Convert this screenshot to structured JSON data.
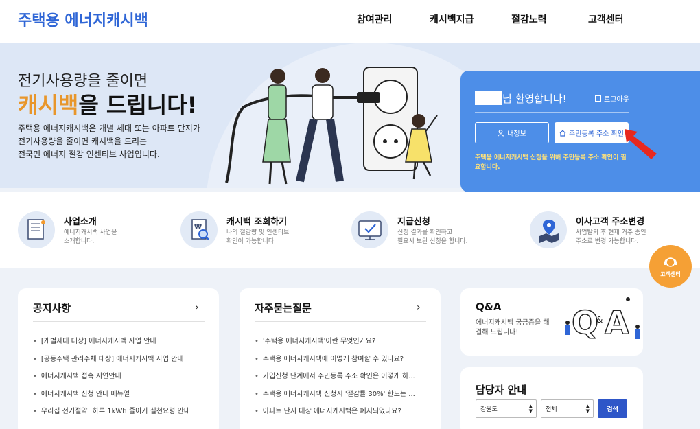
{
  "header": {
    "logo": "주택용 에너지캐시백",
    "nav": [
      "참여관리",
      "캐시백지급",
      "절감노력",
      "고객센터"
    ]
  },
  "hero": {
    "title_line1": "전기사용량을 줄이면",
    "title_highlight": "캐시백",
    "title_rest": "을 드립니다!",
    "desc_lines": [
      "주택용 에너지캐시백은 개별 세대 또는 아파트 단지가",
      "전기사용량을 줄이면 캐시백을 드리는",
      "전국민 에너지 절감 인센티브 사업입니다."
    ]
  },
  "login_panel": {
    "welcome": "님 환영합니다!",
    "logout": "로그아웃",
    "my_info": "내정보",
    "address_check": "주민등록 주소 확인",
    "notice": "주택용 에너지캐시백 신청을 위해 주민등록 주소 확인이 필요합니다."
  },
  "services": [
    {
      "title": "사업소개",
      "desc": [
        "에너지캐시백 사업을",
        "소개합니다."
      ],
      "icon": "document-icon"
    },
    {
      "title": "캐시백 조회하기",
      "desc": [
        "나의 절감량 및 인센티브",
        "확인이 가능합니다."
      ],
      "icon": "won-search-icon"
    },
    {
      "title": "지급신청",
      "desc": [
        "신청 결과를 확인하고",
        "필요시 보완 신청을 합니다."
      ],
      "icon": "monitor-check-icon"
    },
    {
      "title": "이사고객 주소변경",
      "desc": [
        "사업탈퇴 후 현재 거주 중인",
        "주소로 변경 가능합니다."
      ],
      "icon": "map-pin-icon"
    }
  ],
  "cs_button": "고객센터",
  "notices": {
    "title": "공지사항",
    "items": [
      "[개별세대 대상] 에너지캐시백 사업 안내",
      "[공동주택 관리주체 대상] 에너지캐시백 사업 안내",
      "에너지캐시백 접속 지연안내",
      "에너지캐시백 신청 안내 매뉴얼",
      "우리집 전기절약! 하루 1kWh 줄이기 실천요령 안내"
    ]
  },
  "faq": {
    "title": "자주묻는질문",
    "items": [
      "'주택용 에너지캐시백'이란 무엇인가요?",
      "주택용 에너지캐시백에 어떻게 참여할 수 있나요?",
      "가입신청 단계에서 주민등록 주소 확인은 어떻게 하...",
      "주택용 에너지캐시백 신청시 '절감률 30%' 한도는 ...",
      "아파트 단지 대상 에너지캐시백은 폐지되었나요?"
    ]
  },
  "qa": {
    "title": "Q&A",
    "desc": "에너지캐시백 궁금증을 해결해 드립니다!"
  },
  "staff": {
    "title": "담당자 안내",
    "region": "강원도",
    "district": "전체",
    "search": "검색"
  },
  "colors": {
    "brand_blue": "#2f66d6",
    "panel_blue": "#4d8ee8",
    "highlight_orange": "#e8962b",
    "cs_orange": "#f5a035",
    "search_blue": "#2e56c8"
  }
}
